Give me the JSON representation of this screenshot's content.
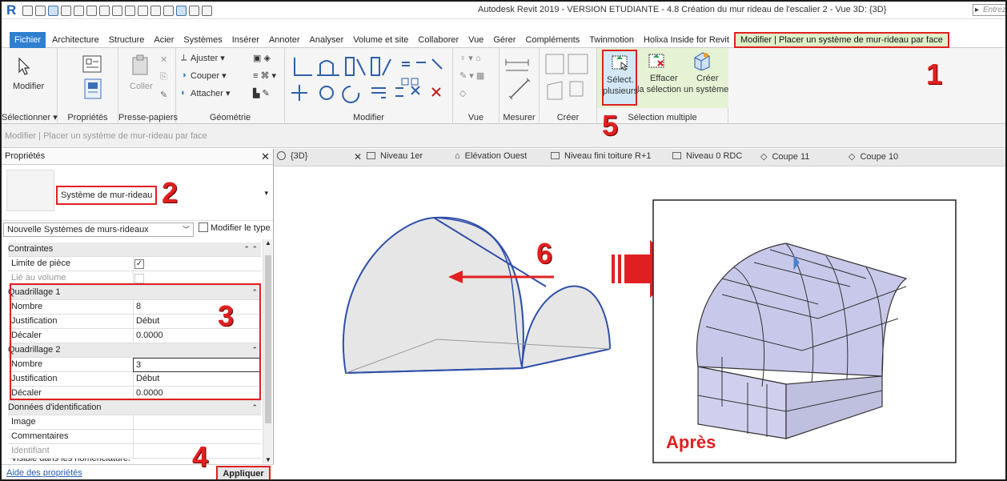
{
  "window": {
    "app_letter": "R",
    "title": "Autodesk Revit 2019 - VERSION ETUDIANTE - 4.8 Création du mur rideau de l'escalier 2 - Vue 3D: {3D}",
    "search_placeholder": "Entrez"
  },
  "menu_tabs": [
    {
      "label": "Fichier"
    },
    {
      "label": "Architecture"
    },
    {
      "label": "Structure"
    },
    {
      "label": "Acier"
    },
    {
      "label": "Systèmes"
    },
    {
      "label": "Insérer"
    },
    {
      "label": "Annoter"
    },
    {
      "label": "Analyser"
    },
    {
      "label": "Volume et site"
    },
    {
      "label": "Collaborer"
    },
    {
      "label": "Vue"
    },
    {
      "label": "Gérer"
    },
    {
      "label": "Compléments"
    },
    {
      "label": "Twinmotion"
    },
    {
      "label": "Holixa Inside for Revit"
    },
    {
      "label": "Modifier | Placer un système de mur-rideau par face"
    }
  ],
  "ribbon": {
    "modify_label": "Modifier",
    "paste_label": "Coller",
    "geom": {
      "trim": "Ajuster",
      "cut": "Couper",
      "join": "Attacher"
    },
    "select_multi": {
      "label1": "Sélect.",
      "label2": "plusieurs"
    },
    "clear_sel": {
      "label1": "Effacer",
      "label2": "la sélection"
    },
    "create_sys": {
      "label1": "Créer",
      "label2": "un système"
    },
    "panels": [
      {
        "label": "Sélectionner ▾"
      },
      {
        "label": "Propriétés"
      },
      {
        "label": "Presse-papiers"
      },
      {
        "label": "Géométrie"
      },
      {
        "label": "Modifier"
      },
      {
        "label": "Vue"
      },
      {
        "label": "Mesurer"
      },
      {
        "label": "Créer"
      },
      {
        "label": "Sélection multiple"
      }
    ]
  },
  "context_bar": "Modifier | Placer un système de mur-rideau par face",
  "properties": {
    "title": "Propriétés",
    "type_name": "Système de mur-rideau",
    "type_selector": "Nouvelle Systèmes de murs-rideaux",
    "edit_type": "Modifier le type",
    "sections": {
      "constraints": "Contraintes",
      "grid1": "Quadrillage 1",
      "grid2": "Quadrillage 2",
      "identity": "Données d'identification"
    },
    "rows": {
      "limit": "Limite de pièce",
      "linked": "Lié au volume",
      "g1_number_k": "Nombre",
      "g1_number_v": "8",
      "g1_just_k": "Justification",
      "g1_just_v": "Début",
      "g1_offset_k": "Décaler",
      "g1_offset_v": "0.0000",
      "g2_number_k": "Nombre",
      "g2_number_v": "3",
      "g2_just_k": "Justification",
      "g2_just_v": "Début",
      "g2_offset_k": "Décaler",
      "g2_offset_v": "0.0000",
      "image": "Image",
      "comments": "Commentaires",
      "identifier": "Identifiant",
      "visible": "Visible dans les nomenclatures"
    },
    "help_link": "Aide des propriétés",
    "apply": "Appliquer"
  },
  "view_tabs": [
    {
      "label": "{3D}"
    },
    {
      "label": "Niveau 1er"
    },
    {
      "label": "Elévation Ouest"
    },
    {
      "label": "Niveau fini toiture R+1"
    },
    {
      "label": "Niveau 0 RDC"
    },
    {
      "label": "Coupe 11"
    },
    {
      "label": "Coupe 10"
    }
  ],
  "annotations": {
    "n1": "1",
    "n2": "2",
    "n3": "3",
    "n4": "4",
    "n5": "5",
    "n6": "6",
    "after": "Après"
  },
  "colors": {
    "accent_red": "#e02020",
    "file_tab": "#2f7fd0",
    "context_green": "#dff0c8"
  }
}
